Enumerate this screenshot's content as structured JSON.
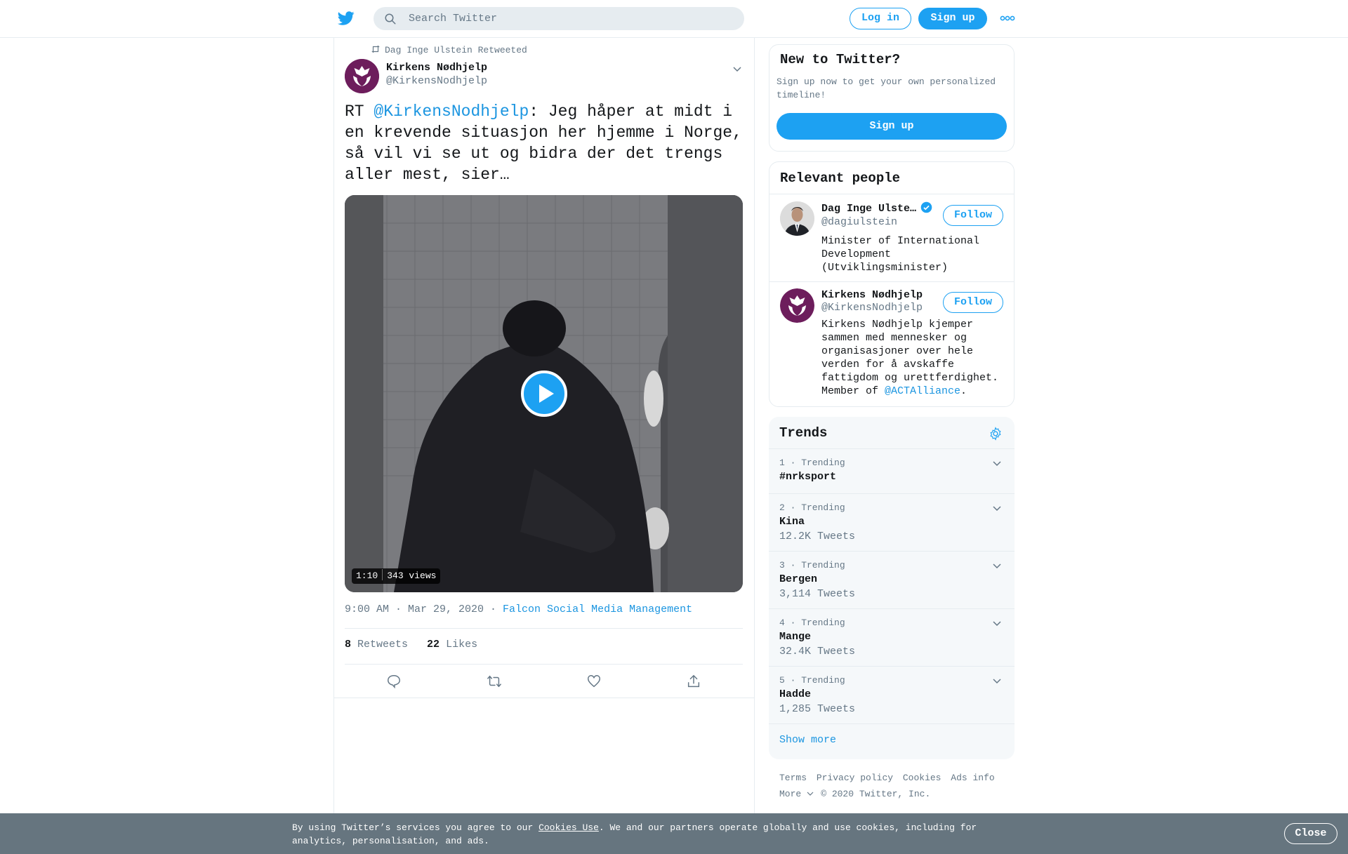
{
  "header": {
    "logo_icon": "twitter-bird-icon",
    "search_placeholder": "Search Twitter",
    "login_label": "Log in",
    "signup_label": "Sign up",
    "more_icon": "more-dots-icon"
  },
  "tweet": {
    "retweeted_by": "Dag Inge Ulstein Retweeted",
    "author_name": "Kirkens Nødhjelp",
    "author_handle": "@KirkensNodhjelp",
    "text_prefix": "RT ",
    "text_mention": "@KirkensNodhjelp",
    "text_rest": ": Jeg håper at midt i en krevende situasjon her hjemme i Norge, så vil vi se ut og bidra der det trengs aller mest, sier…",
    "video_duration": "1:10",
    "video_views": "343 views",
    "timestamp": "9:00 AM · Mar 29, 2020 · ",
    "source": "Falcon Social Media Management",
    "retweets_count": "8",
    "retweets_label": " Retweets",
    "likes_count": "22",
    "likes_label": " Likes"
  },
  "new_to_twitter": {
    "title": "New to Twitter?",
    "description": "Sign up now to get your own personalized timeline!",
    "signup_label": "Sign up"
  },
  "relevant_people": {
    "title": "Relevant people",
    "people": [
      {
        "name": "Dag Inge Ulste…",
        "handle": "@dagiulstein",
        "follow_label": "Follow",
        "bio": "Minister of International Development (Utviklingsminister)",
        "verified": true
      },
      {
        "name": "Kirkens Nødhjelp",
        "handle": "@KirkensNodhjelp",
        "follow_label": "Follow",
        "bio_text": "Kirkens Nødhjelp kjemper sammen med mennesker og organisasjoner over hele verden for å avskaffe fattigdom og urettferdighet. Member of ",
        "bio_mention": "@ACTAlliance",
        "bio_end": "."
      }
    ]
  },
  "trends": {
    "title": "Trends",
    "items": [
      {
        "meta": "1 · Trending",
        "name": "#nrksport",
        "count": ""
      },
      {
        "meta": "2 · Trending",
        "name": "Kina",
        "count": "12.2K Tweets"
      },
      {
        "meta": "3 · Trending",
        "name": "Bergen",
        "count": "3,114 Tweets"
      },
      {
        "meta": "4 · Trending",
        "name": "Mange",
        "count": "32.4K Tweets"
      },
      {
        "meta": "5 · Trending",
        "name": "Hadde",
        "count": "1,285 Tweets"
      }
    ],
    "show_more": "Show more"
  },
  "footer": {
    "links": [
      "Terms",
      "Privacy policy",
      "Cookies",
      "Ads info"
    ],
    "more_label": "More",
    "copyright": "© 2020 Twitter, Inc."
  },
  "cookie_bar": {
    "text_before": "By using Twitter’s services you agree to our ",
    "link": "Cookies Use",
    "text_after": ". We and our partners operate globally and use cookies, including for analytics, personalisation, and ads.",
    "close_label": "Close"
  },
  "colors": {
    "accent": "#1da1f2",
    "link": "#1b95e0",
    "brand_avatar": "#6d1d5c",
    "cookie_bar": "#66757f"
  }
}
